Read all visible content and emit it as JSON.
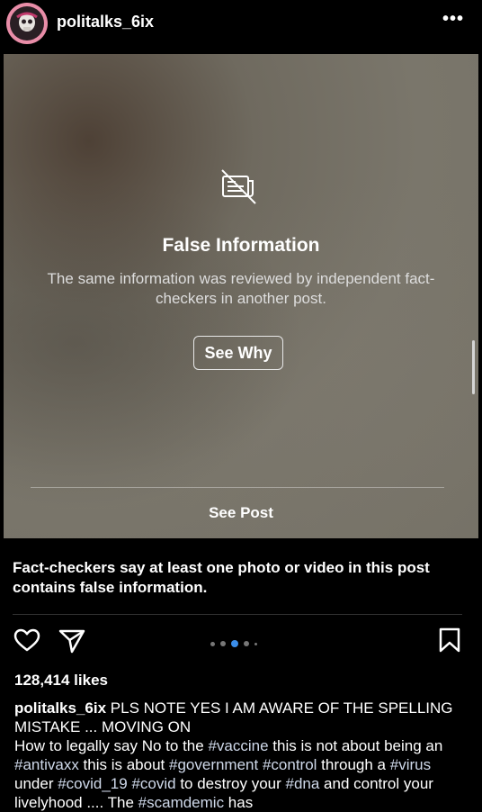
{
  "header": {
    "username": "politalks_6ix",
    "more_label": "•••"
  },
  "media": {
    "title": "False Information",
    "description": "The same information was reviewed by independent fact-checkers in another post.",
    "see_why_label": "See Why",
    "see_post_label": "See Post"
  },
  "notice": "Fact-checkers say at least one photo or video in this post contains false information.",
  "likes": "128,414 likes",
  "caption": {
    "username": "politalks_6ix",
    "lead": "PLS NOTE YES I AM AWARE OF THE SPELLING MISTAKE ... MOVING ON",
    "p1": "How to legally say No to the ",
    "h1": "#vaccine",
    "p2": " this is not about being an ",
    "h2": "#antivaxx",
    "p3": " this is about ",
    "h3": "#government",
    "p4": " ",
    "h4": "#control",
    "p5": " through a ",
    "h5": "#virus",
    "p6": " under ",
    "h6": "#covid_19",
    "p7": " ",
    "h7": "#covid",
    "p8": " to destroy your ",
    "h8": "#dna",
    "p9": " and control your livelyhood .... The ",
    "h9": "#scamdemic",
    "p10": " has"
  },
  "icons": {
    "heart": "heart-icon",
    "share": "paper-plane-icon",
    "save": "bookmark-icon",
    "false_info": "crossed-out-newspaper-icon",
    "more": "more-options-icon"
  },
  "carousel": {
    "total": 5,
    "active": 3
  },
  "colors": {
    "background": "#000000",
    "hashtag": "#cfd9ea",
    "active_dot": "#3b8eea"
  }
}
